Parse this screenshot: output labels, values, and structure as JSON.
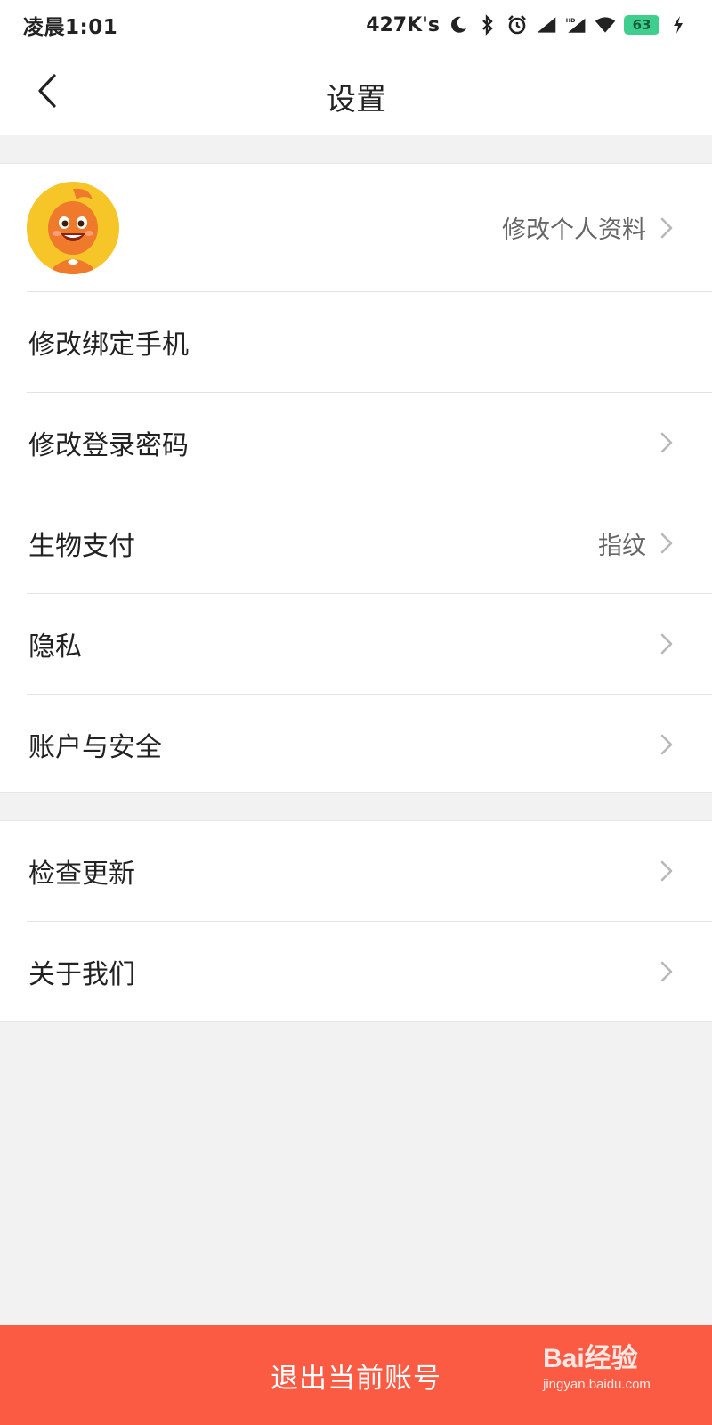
{
  "status_bar": {
    "time": "凌晨1:01",
    "net_speed": "427K's",
    "battery": "63",
    "icons": [
      "moon-icon",
      "bluetooth-icon",
      "alarm-icon",
      "signal-icon",
      "hd-signal-icon",
      "wifi-icon",
      "battery-icon",
      "charging-icon"
    ]
  },
  "header": {
    "title": "设置"
  },
  "profile": {
    "edit_label": "修改个人资料"
  },
  "settings_group_1": [
    {
      "label": "修改绑定手机",
      "value": "",
      "chevron": false
    },
    {
      "label": "修改登录密码",
      "value": "",
      "chevron": true
    },
    {
      "label": "生物支付",
      "value": "指纹",
      "chevron": true
    },
    {
      "label": "隐私",
      "value": "",
      "chevron": true
    },
    {
      "label": "账户与安全",
      "value": "",
      "chevron": true
    }
  ],
  "settings_group_2": [
    {
      "label": "检查更新",
      "value": "",
      "chevron": true
    },
    {
      "label": "关于我们",
      "value": "",
      "chevron": true
    }
  ],
  "logout": {
    "label": "退出当前账号"
  },
  "watermark": {
    "logo": "Bai经验",
    "sub": "jingyan.baidu.com"
  },
  "colors": {
    "accent": "#fb5a43",
    "battery": "#3ecf8e",
    "avatar_bg": "#f6c629"
  }
}
